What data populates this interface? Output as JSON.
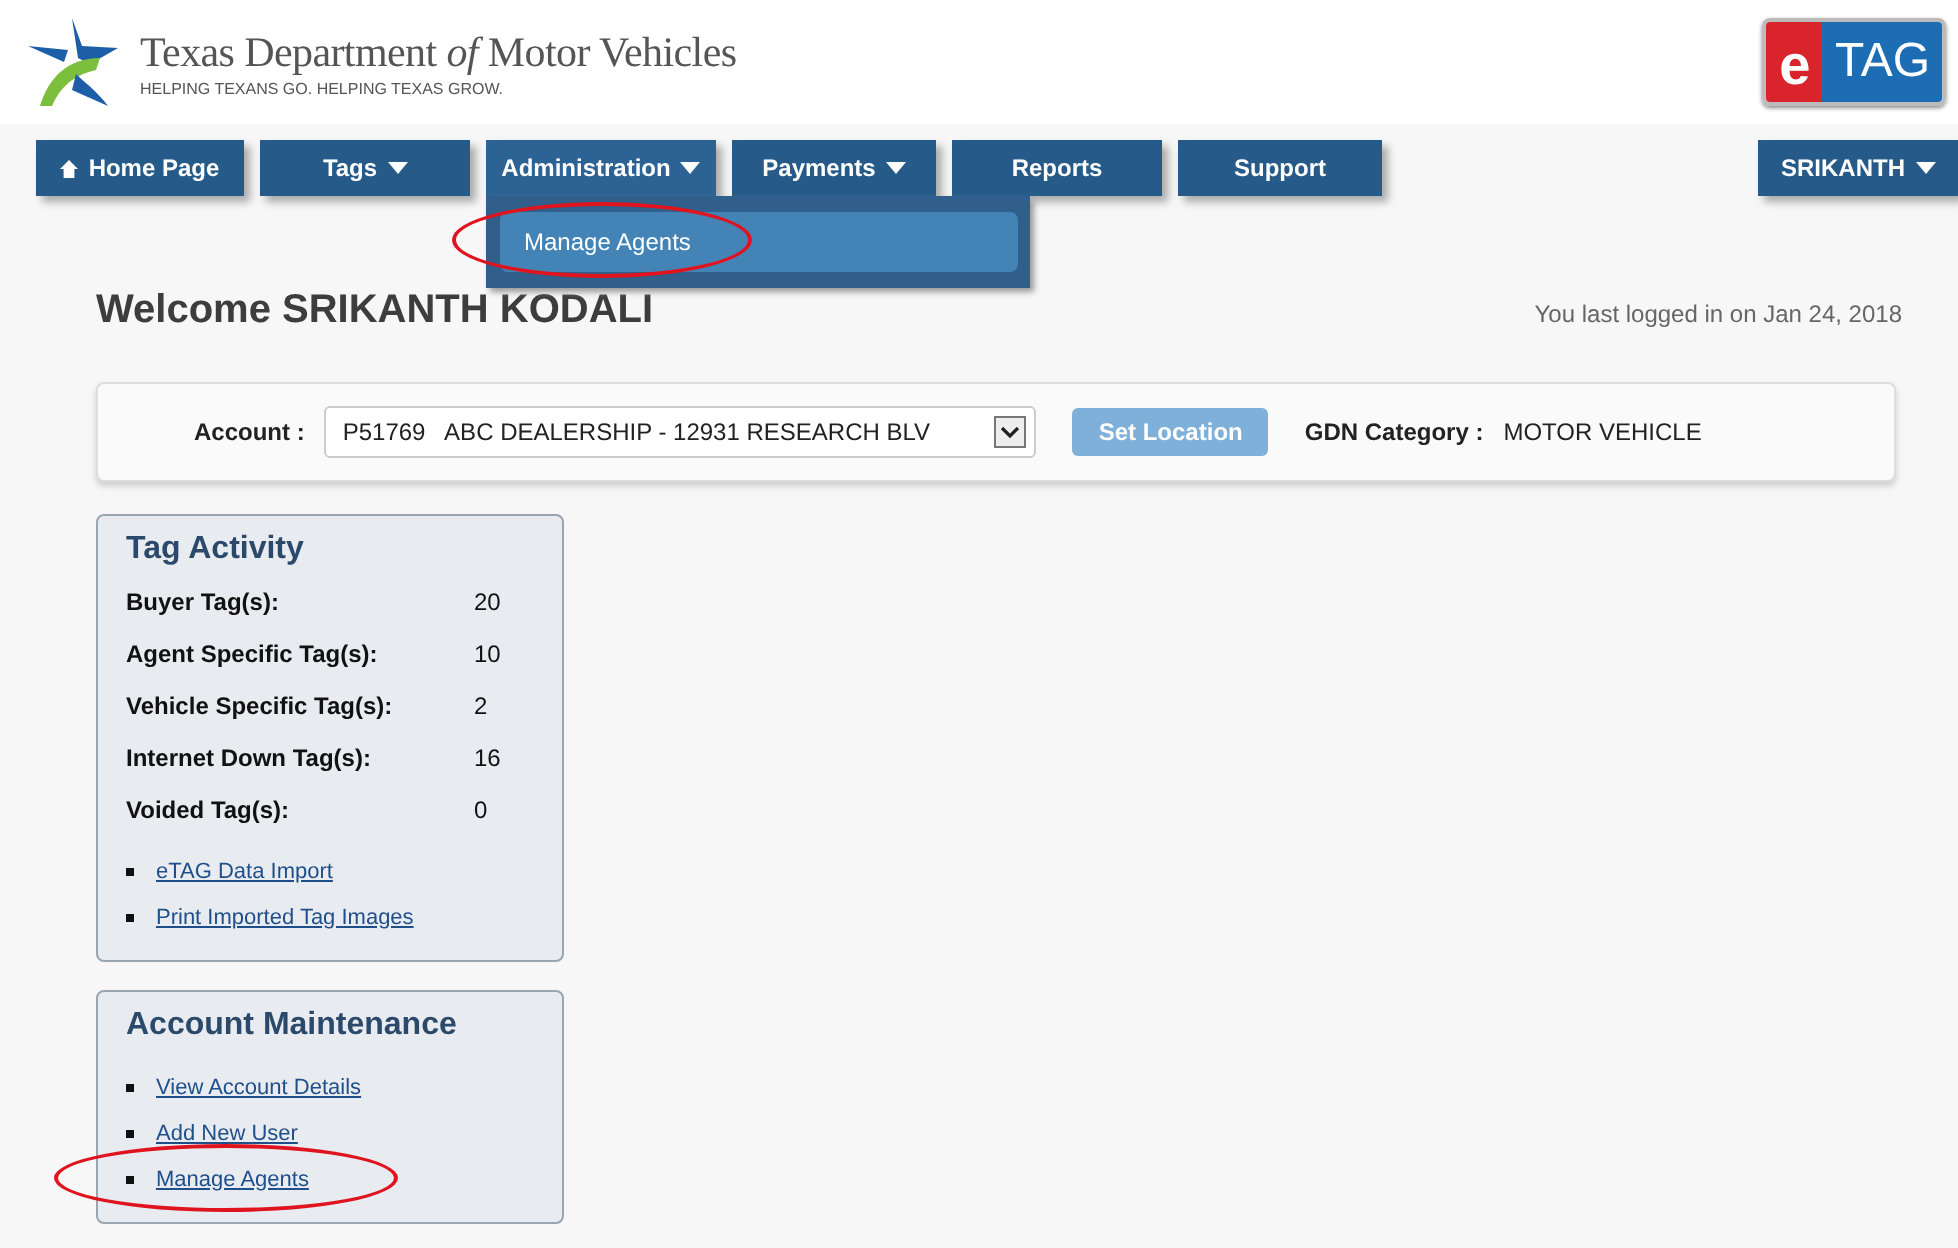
{
  "header": {
    "agency_name": "Texas Department *of* Motor Vehicles",
    "tagline": "HELPING TEXANS GO. HELPING TEXAS GROW.",
    "badge": {
      "left": "e",
      "right": "TAG"
    }
  },
  "nav": [
    {
      "label": "Home Page",
      "kind": "home",
      "dropdown": false,
      "expanded": false
    },
    {
      "label": "Tags",
      "kind": "plain",
      "dropdown": true,
      "expanded": false
    },
    {
      "label": "Administration",
      "kind": "plain",
      "dropdown": true,
      "expanded": true,
      "menu": [
        {
          "label": "Manage Agents",
          "highlighted": true
        }
      ]
    },
    {
      "label": "Payments",
      "kind": "plain",
      "dropdown": true,
      "expanded": false
    },
    {
      "label": "Reports",
      "kind": "plain",
      "dropdown": false,
      "expanded": false
    },
    {
      "label": "Support",
      "kind": "plain",
      "dropdown": false,
      "expanded": false
    }
  ],
  "user_menu": {
    "label": "SRIKANTH",
    "dropdown": true
  },
  "welcome": "Welcome SRIKANTH KODALI",
  "last_login": "You last logged in on Jan 24, 2018",
  "account_bar": {
    "account_label": "Account :",
    "account_value": "P51769   ABC DEALERSHIP - 12931 RESEARCH BLV",
    "button": "Set Location",
    "button_disabled": true,
    "category_label": "GDN Category :",
    "category_value": "MOTOR VEHICLE"
  },
  "tag_activity": {
    "title": "Tag Activity",
    "rows": [
      {
        "label": "Buyer Tag(s):",
        "value": "20"
      },
      {
        "label": "Agent Specific Tag(s):",
        "value": "10"
      },
      {
        "label": "Vehicle Specific Tag(s):",
        "value": "2"
      },
      {
        "label": "Internet Down Tag(s):",
        "value": "16"
      },
      {
        "label": "Voided Tag(s):",
        "value": "0"
      }
    ],
    "links": [
      {
        "label": "eTAG Data Import",
        "highlighted": false
      },
      {
        "label": "Print Imported Tag Images",
        "highlighted": false
      }
    ]
  },
  "account_maintenance": {
    "title": "Account Maintenance",
    "links": [
      {
        "label": "View Account Details",
        "highlighted": false
      },
      {
        "label": "Add New User",
        "highlighted": false
      },
      {
        "label": "Manage Agents",
        "highlighted": true
      }
    ]
  }
}
